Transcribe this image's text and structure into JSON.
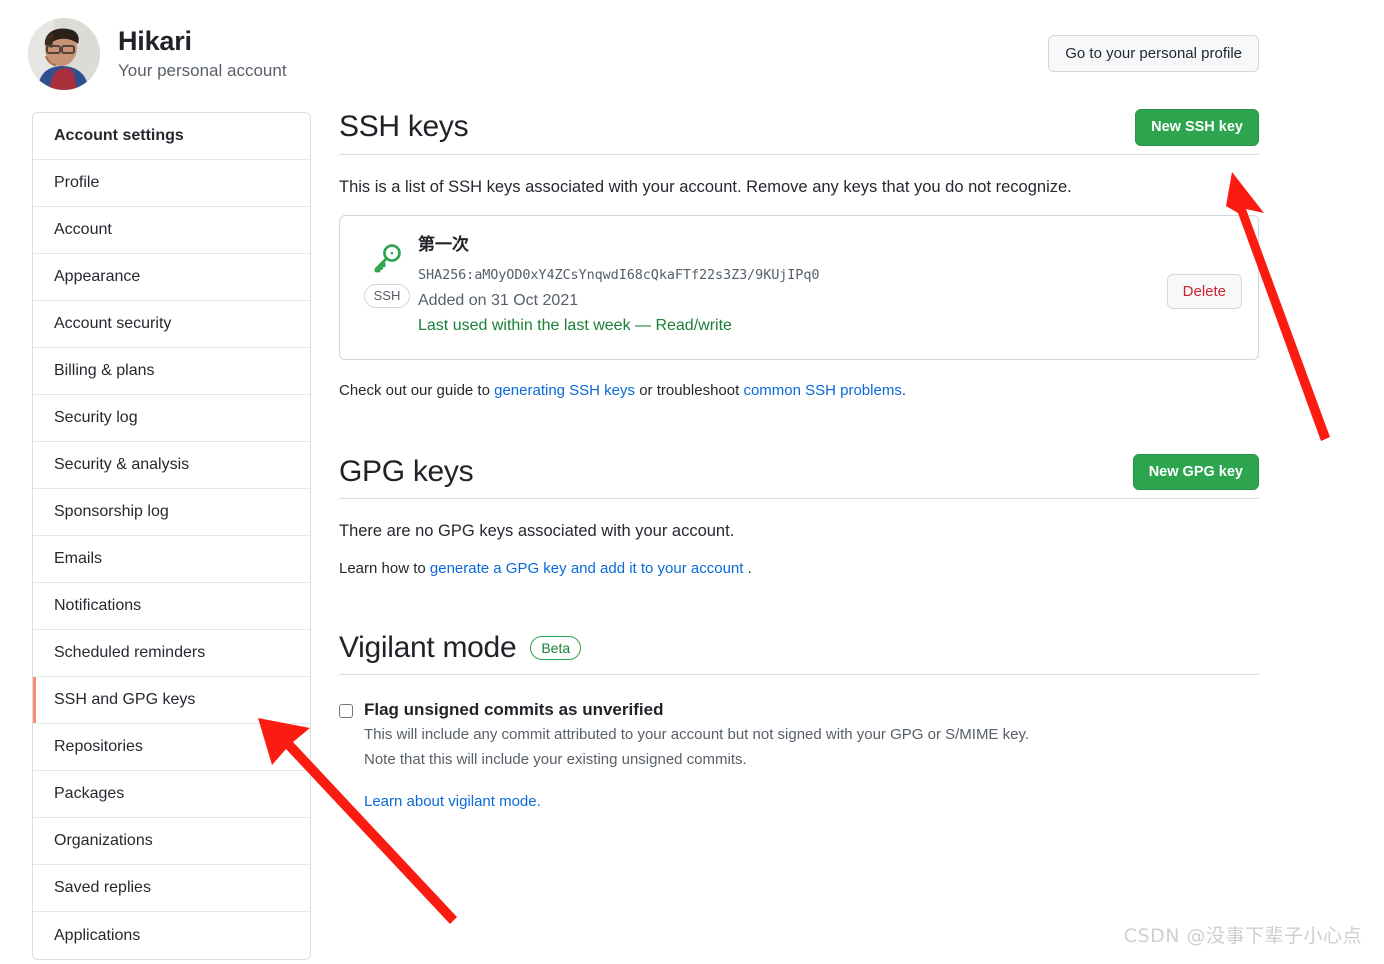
{
  "account": {
    "name": "Hikari",
    "subtitle": "Your personal account",
    "profile_button": "Go to your personal profile"
  },
  "sidebar": {
    "heading": "Account settings",
    "items": [
      {
        "label": "Profile",
        "selected": false
      },
      {
        "label": "Account",
        "selected": false
      },
      {
        "label": "Appearance",
        "selected": false
      },
      {
        "label": "Account security",
        "selected": false
      },
      {
        "label": "Billing & plans",
        "selected": false
      },
      {
        "label": "Security log",
        "selected": false
      },
      {
        "label": "Security & analysis",
        "selected": false
      },
      {
        "label": "Sponsorship log",
        "selected": false
      },
      {
        "label": "Emails",
        "selected": false
      },
      {
        "label": "Notifications",
        "selected": false
      },
      {
        "label": "Scheduled reminders",
        "selected": false
      },
      {
        "label": "SSH and GPG keys",
        "selected": true
      },
      {
        "label": "Repositories",
        "selected": false
      },
      {
        "label": "Packages",
        "selected": false
      },
      {
        "label": "Organizations",
        "selected": false
      },
      {
        "label": "Saved replies",
        "selected": false
      },
      {
        "label": "Applications",
        "selected": false
      }
    ]
  },
  "ssh": {
    "title": "SSH keys",
    "new_button": "New SSH key",
    "description": "This is a list of SSH keys associated with your account. Remove any keys that you do not recognize.",
    "key": {
      "name": "第一次",
      "fingerprint": "SHA256:aMOyOD0xY4ZCsYnqwdI68cQkaFTf22s3Z3/9KUjIPq0",
      "added": "Added on 31 Oct 2021",
      "last_used": "Last used within the last week — Read/write",
      "badge": "SSH",
      "delete_label": "Delete"
    },
    "guide_prefix": "Check out our guide to ",
    "guide_link1": "generating SSH keys",
    "guide_middle": " or troubleshoot ",
    "guide_link2": "common SSH problems",
    "guide_suffix": "."
  },
  "gpg": {
    "title": "GPG keys",
    "new_button": "New GPG key",
    "empty_text": "There are no GPG keys associated with your account.",
    "learn_prefix": "Learn how to ",
    "learn_link": "generate a GPG key and add it to your account",
    "learn_suffix": " ."
  },
  "vigilant": {
    "title": "Vigilant mode",
    "badge": "Beta",
    "checkbox_label": "Flag unsigned commits as unverified",
    "checkbox_checked": false,
    "note_line1": "This will include any commit attributed to your account but not signed with your GPG or S/MIME key.",
    "note_line2": "Note that this will include your existing unsigned commits.",
    "learn_link": "Learn about vigilant mode."
  },
  "annotations": {
    "arrow_color": "#fc1b10",
    "arrow_1_desc": "arrow pointing to New SSH key button",
    "arrow_2_desc": "arrow pointing to SSH and GPG keys sidebar item"
  },
  "watermark": "CSDN @没事下辈子小心点",
  "colors": {
    "green": "#2da44e",
    "link": "#0969da",
    "danger": "#cf222e",
    "selected_bar": "#fd8c73"
  }
}
